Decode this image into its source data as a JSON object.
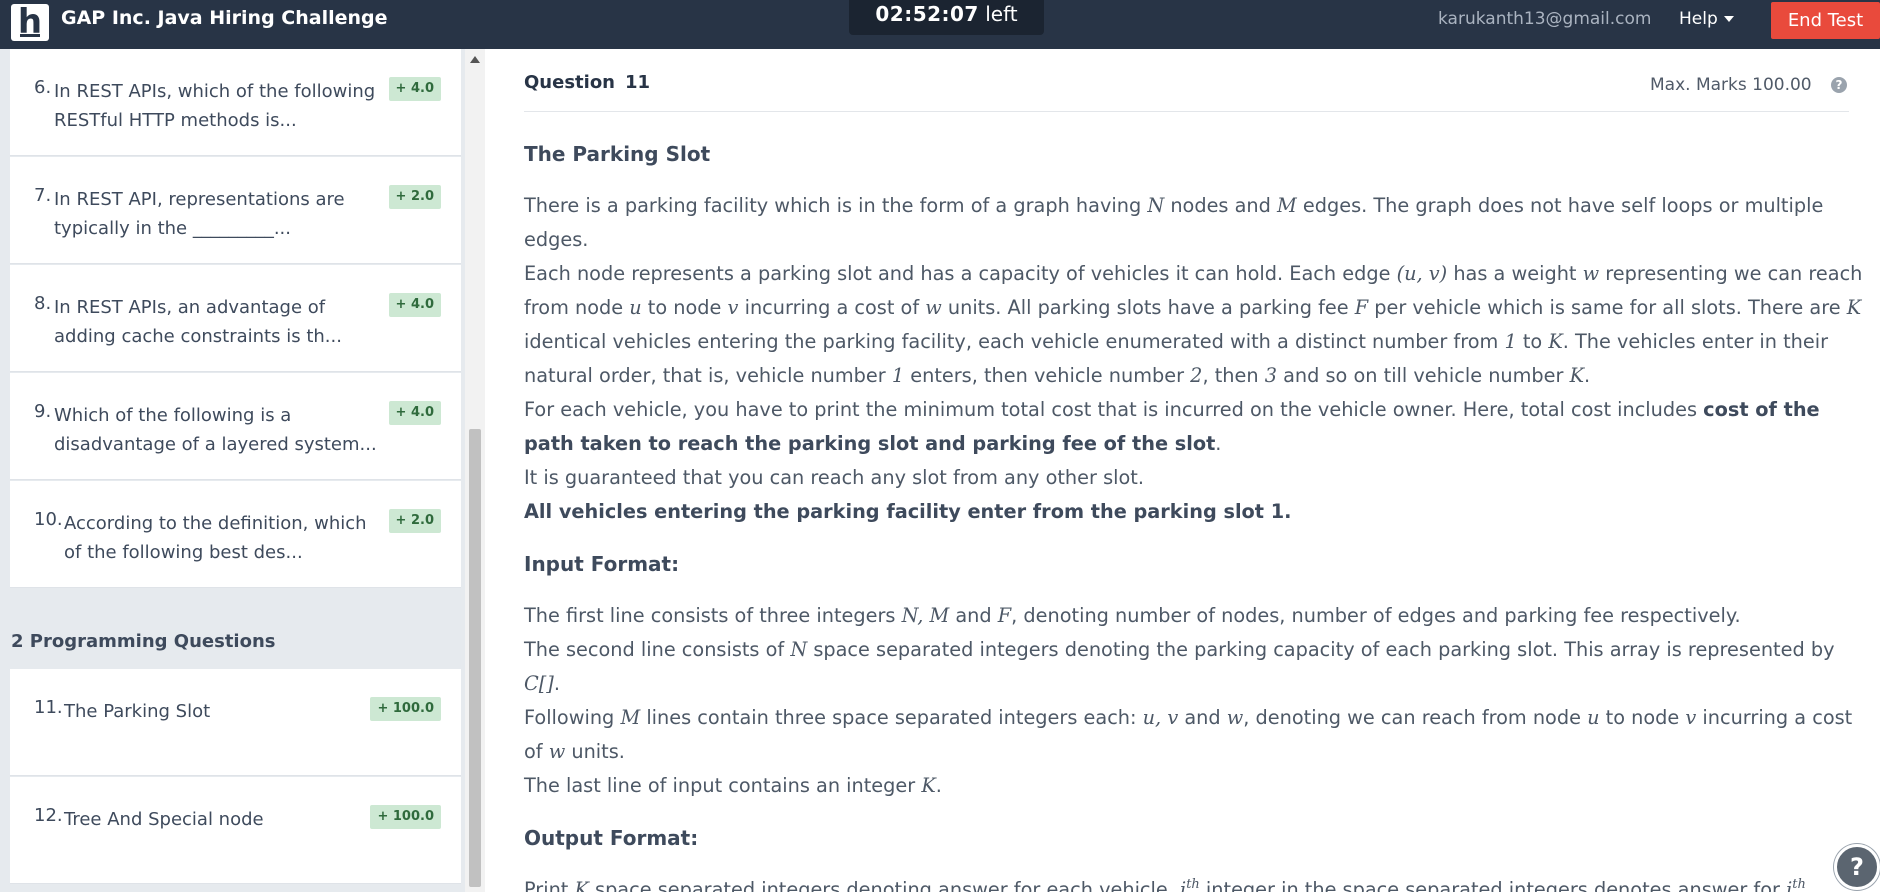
{
  "header": {
    "logo_letter": "h",
    "title": "GAP Inc. Java Hiring Challenge",
    "timer_value": "02:52:07",
    "timer_suffix": "left",
    "email": "karukanth13@gmail.com",
    "help_label": "Help",
    "end_test_label": "End Test"
  },
  "sidebar": {
    "questions": [
      {
        "num": "6.",
        "text": "In REST APIs, which of the following RESTful HTTP methods is...",
        "marks": "+ 4.0"
      },
      {
        "num": "7.",
        "text": "In REST API, representations are typically in the _________...",
        "marks": "+ 2.0"
      },
      {
        "num": "8.",
        "text": "In REST APIs, an advantage of adding cache constraints is th...",
        "marks": "+ 4.0"
      },
      {
        "num": "9.",
        "text": "Which of the following is a disadvantage of a layered system...",
        "marks": "+ 4.0"
      },
      {
        "num": "10.",
        "text": "According to the definition, which of the following best des...",
        "marks": "+ 2.0"
      }
    ],
    "section_title": "2 Programming Questions",
    "programming": [
      {
        "num": "11.",
        "text": "The Parking Slot",
        "marks": "+ 100.0"
      },
      {
        "num": "12.",
        "text": "Tree And Special node",
        "marks": "+ 100.0"
      }
    ]
  },
  "main": {
    "question_label": "Question",
    "question_number": "11",
    "max_marks": "Max. Marks 100.00",
    "help_icon": "?",
    "title": "The Parking Slot",
    "input_format_title": "Input Format:",
    "output_format_title": "Output Format:"
  },
  "floating_help": "?"
}
